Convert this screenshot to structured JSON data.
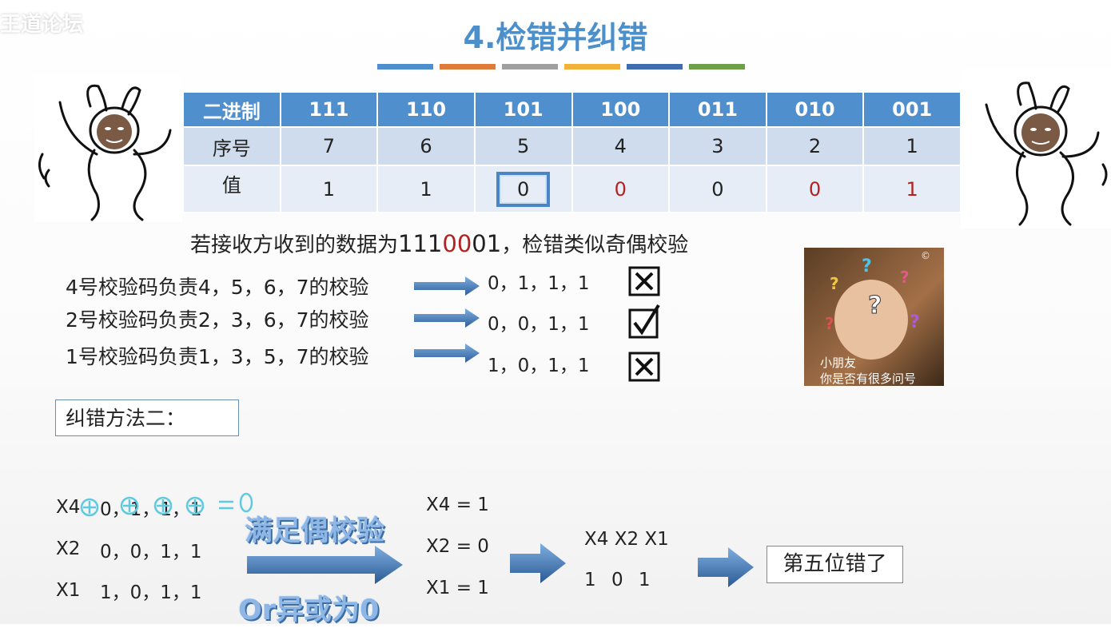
{
  "watermark": {
    "text": "王道论坛"
  },
  "slide": {
    "title": "4.检错并纠错"
  },
  "colors": {
    "bars": [
      "#4f8fce",
      "#de7a3a",
      "#a0a0a0",
      "#f2b23a",
      "#3f6db0",
      "#6ea04a"
    ]
  },
  "table": {
    "row_labels": [
      "二进制",
      "序号",
      "值"
    ],
    "binary": [
      "111",
      "110",
      "101",
      "100",
      "011",
      "010",
      "001"
    ],
    "index": [
      "7",
      "6",
      "5",
      "4",
      "3",
      "2",
      "1"
    ],
    "values": [
      "1",
      "1",
      "0",
      "0",
      "0",
      "0",
      "1"
    ]
  },
  "received": {
    "prefix": "若接收方收到的数据为",
    "data_black": "111",
    "data_red": "00",
    "data_black2": "01",
    "suffix": "，检错类似奇偶校验"
  },
  "checks": [
    {
      "label": "4号校验码负责4，5，6，7的校验",
      "result": "0，1，1，1",
      "mark": "cross"
    },
    {
      "label": "2号校验码负责2，3，6，7的校验",
      "result": "0，0，1，1",
      "mark": "check"
    },
    {
      "label": "1号校验码负责1，3，5，7的校验",
      "result": "1，0，1，1",
      "mark": "cross"
    }
  ],
  "meme_kid": {
    "caption1": "小朋友",
    "caption2": "你是否有很多问号"
  },
  "method": {
    "label": "纠错方法二："
  },
  "xor_rows": [
    {
      "label": "X4",
      "values": "0，1，1，1"
    },
    {
      "label": "X2",
      "values": "0，0，1，1"
    },
    {
      "label": "X1",
      "values": "1，0，1，1"
    }
  ],
  "banner": {
    "top": "满足偶校验",
    "bottom": "Or异或为0"
  },
  "equations": [
    "X4 = 1",
    "X2 = 0",
    "X1 = 1"
  ],
  "bits_result": {
    "head": "X4 X2 X1",
    "vals": "1 0 1"
  },
  "result": {
    "text": "第五位错了"
  }
}
